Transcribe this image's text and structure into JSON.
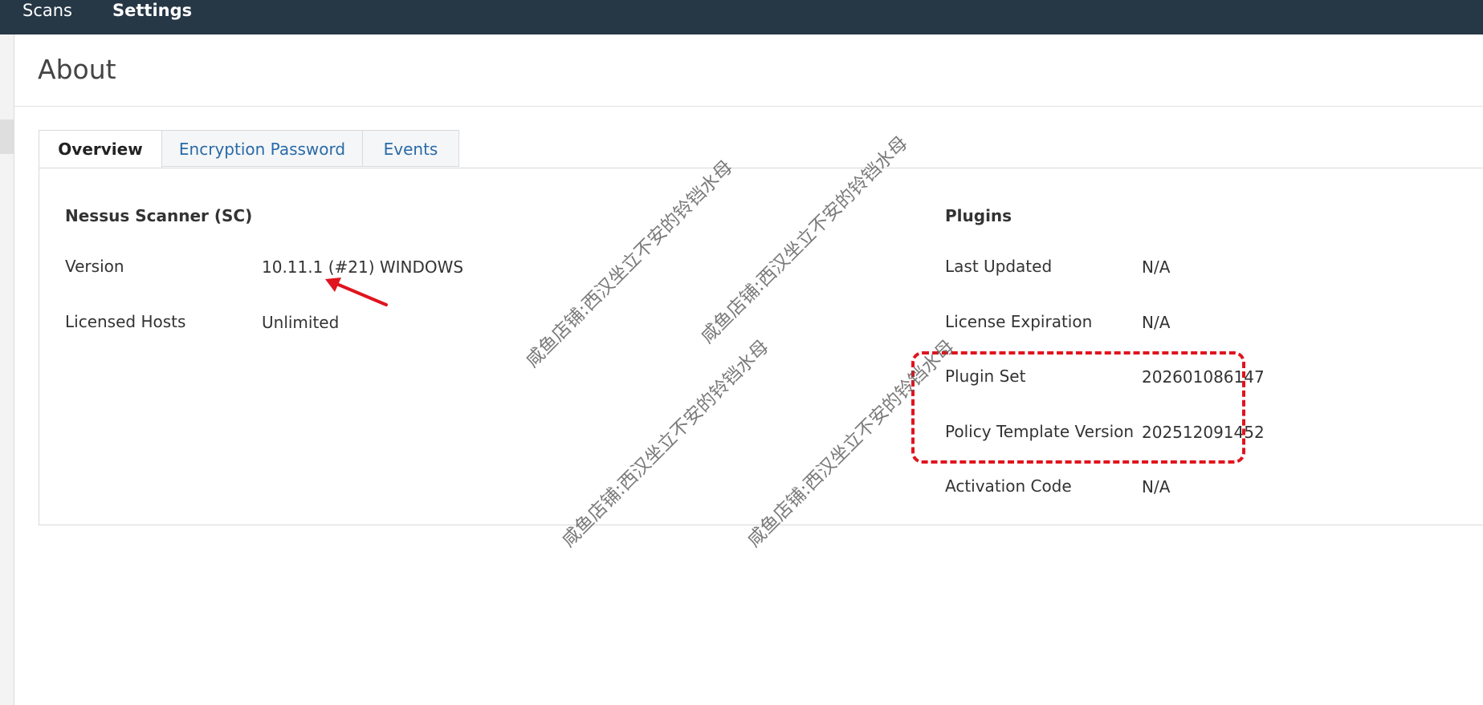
{
  "topnav": {
    "scans_label": "Scans",
    "settings_label": "Settings"
  },
  "page": {
    "title": "About"
  },
  "tabs": [
    {
      "label": "Overview",
      "active": true
    },
    {
      "label": "Encryption Password",
      "active": false
    },
    {
      "label": "Events",
      "active": false
    }
  ],
  "scanner": {
    "title": "Nessus Scanner (SC)",
    "rows": [
      {
        "label": "Version",
        "value": "10.11.1 (#21) WINDOWS"
      },
      {
        "label": "Licensed Hosts",
        "value": "Unlimited"
      }
    ]
  },
  "plugins": {
    "title": "Plugins",
    "rows": [
      {
        "label": "Last Updated",
        "value": "N/A"
      },
      {
        "label": "License Expiration",
        "value": "N/A"
      },
      {
        "label": "Plugin Set",
        "value": "202601086147"
      },
      {
        "label": "Policy Template Version",
        "value": "202512091452"
      },
      {
        "label": "Activation Code",
        "value": "N/A"
      }
    ]
  },
  "watermark_text": "咸鱼店铺:西汉坐立不安的铃铛水母",
  "colors": {
    "topbar": "#263746",
    "link": "#2a6aa6",
    "annotation": "#e0141e"
  }
}
